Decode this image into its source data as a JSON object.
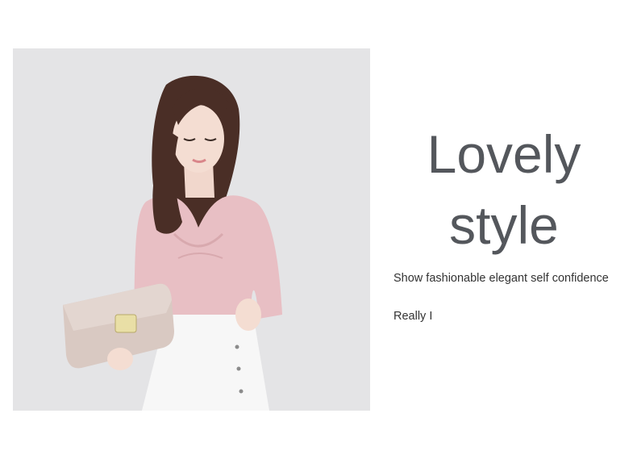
{
  "headline": {
    "line1": "Lovely",
    "line2": "style"
  },
  "tagline": "Show fashionable elegant self confidence",
  "note": "Really I",
  "colors": {
    "headline": "#54575c",
    "body_text": "#333333",
    "photo_background": "#e4e4e6",
    "top_pink": "#e8bfc4",
    "skirt_white": "#f7f7f7",
    "clutch": "#d9c9c2"
  }
}
